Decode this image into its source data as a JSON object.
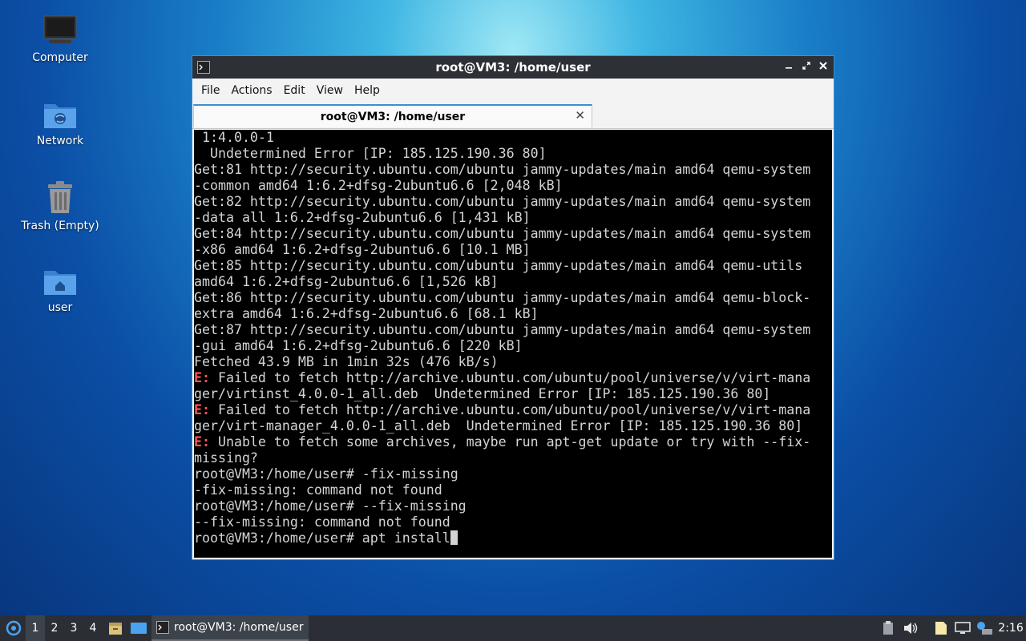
{
  "desktop": {
    "icons": [
      {
        "label": "Computer"
      },
      {
        "label": "Network"
      },
      {
        "label": "Trash (Empty)"
      },
      {
        "label": "user"
      }
    ]
  },
  "window": {
    "title": "root@VM3: /home/user",
    "menu": [
      "File",
      "Actions",
      "Edit",
      "View",
      "Help"
    ],
    "tab_title": "root@VM3: /home/user",
    "controls": {
      "minimize": "minimize",
      "maximize": "maximize",
      "close": "close"
    }
  },
  "terminal": {
    "lines": [
      {
        "prefix": "",
        "text": " 1:4.0.0-1"
      },
      {
        "prefix": "",
        "text": "  Undetermined Error [IP: 185.125.190.36 80]"
      },
      {
        "prefix": "",
        "text": "Get:81 http://security.ubuntu.com/ubuntu jammy-updates/main amd64 qemu-system"
      },
      {
        "prefix": "",
        "text": "-common amd64 1:6.2+dfsg-2ubuntu6.6 [2,048 kB]"
      },
      {
        "prefix": "",
        "text": "Get:82 http://security.ubuntu.com/ubuntu jammy-updates/main amd64 qemu-system"
      },
      {
        "prefix": "",
        "text": "-data all 1:6.2+dfsg-2ubuntu6.6 [1,431 kB]"
      },
      {
        "prefix": "",
        "text": "Get:84 http://security.ubuntu.com/ubuntu jammy-updates/main amd64 qemu-system"
      },
      {
        "prefix": "",
        "text": "-x86 amd64 1:6.2+dfsg-2ubuntu6.6 [10.1 MB]"
      },
      {
        "prefix": "",
        "text": "Get:85 http://security.ubuntu.com/ubuntu jammy-updates/main amd64 qemu-utils"
      },
      {
        "prefix": "",
        "text": "amd64 1:6.2+dfsg-2ubuntu6.6 [1,526 kB]"
      },
      {
        "prefix": "",
        "text": "Get:86 http://security.ubuntu.com/ubuntu jammy-updates/main amd64 qemu-block-"
      },
      {
        "prefix": "",
        "text": "extra amd64 1:6.2+dfsg-2ubuntu6.6 [68.1 kB]"
      },
      {
        "prefix": "",
        "text": "Get:87 http://security.ubuntu.com/ubuntu jammy-updates/main amd64 qemu-system"
      },
      {
        "prefix": "",
        "text": "-gui amd64 1:6.2+dfsg-2ubuntu6.6 [220 kB]"
      },
      {
        "prefix": "",
        "text": "Fetched 43.9 MB in 1min 32s (476 kB/s)"
      },
      {
        "prefix": "E:",
        "text": " Failed to fetch http://archive.ubuntu.com/ubuntu/pool/universe/v/virt-mana"
      },
      {
        "prefix": "",
        "text": "ger/virtinst_4.0.0-1_all.deb  Undetermined Error [IP: 185.125.190.36 80]"
      },
      {
        "prefix": "E:",
        "text": " Failed to fetch http://archive.ubuntu.com/ubuntu/pool/universe/v/virt-mana"
      },
      {
        "prefix": "",
        "text": "ger/virt-manager_4.0.0-1_all.deb  Undetermined Error [IP: 185.125.190.36 80]"
      },
      {
        "prefix": "E:",
        "text": " Unable to fetch some archives, maybe run apt-get update or try with --fix-"
      },
      {
        "prefix": "",
        "text": "missing?"
      },
      {
        "prefix": "",
        "text": "root@VM3:/home/user# -fix-missing"
      },
      {
        "prefix": "",
        "text": "-fix-missing: command not found"
      },
      {
        "prefix": "",
        "text": "root@VM3:/home/user# --fix-missing"
      },
      {
        "prefix": "",
        "text": "--fix-missing: command not found"
      }
    ],
    "prompt": "root@VM3:/home/user# ",
    "input": "apt install"
  },
  "taskbar": {
    "workspaces": [
      "1",
      "2",
      "3",
      "4"
    ],
    "active_workspace": "1",
    "task_title": "root@VM3: /home/user",
    "clock": "2:16"
  },
  "colors": {
    "error": "#ff5555",
    "accent": "#3a8fd8",
    "panel": "#2b2f35"
  }
}
